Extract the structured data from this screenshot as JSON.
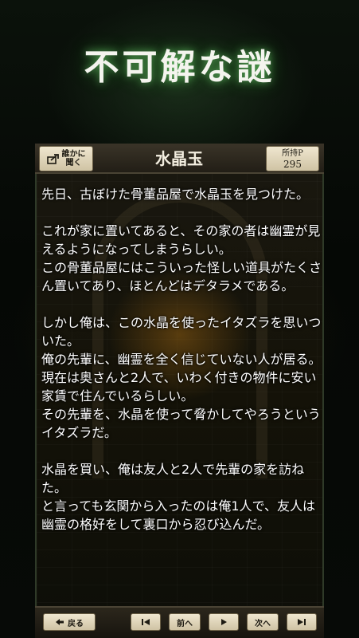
{
  "header": {
    "page_title": "不可解な謎",
    "ask_button_label": "誰かに\n聞く",
    "story_title": "水晶玉",
    "points_label": "所持P",
    "points_value": "295"
  },
  "story": {
    "text": "先日、古ぼけた骨董品屋で水晶玉を見つけた。\n\nこれが家に置いてあると、その家の者は幽霊が見えるようになってしまうらしい。\nこの骨董品屋にはこういった怪しい道具がたくさん置いてあり、ほとんどはデタラメである。\n\nしかし俺は、この水晶を使ったイタズラを思いついた。\n俺の先輩に、幽霊を全く信じていない人が居る。\n現在は奥さんと2人で、いわく付きの物件に安い家賃で住んでいるらしい。\nその先輩を、水晶を使って脅かしてやろうというイタズラだ。\n\n水晶を買い、俺は友人と2人で先輩の家を訪ねた。\nと言っても玄関から入ったのは俺1人で、友人は幽霊の格好をして裏口から忍び込んだ。"
  },
  "footer": {
    "back_label": "戻る",
    "prev_label": "前へ",
    "next_label": "次へ"
  },
  "icons": {
    "ask": "share-icon",
    "back": "arrow-left-icon",
    "first": "skip-first-icon",
    "play": "play-icon",
    "last": "skip-last-icon"
  },
  "colors": {
    "title_glow": "#7cff7c",
    "button_face": "#e6dcc2",
    "panel_bg": "#141208"
  }
}
